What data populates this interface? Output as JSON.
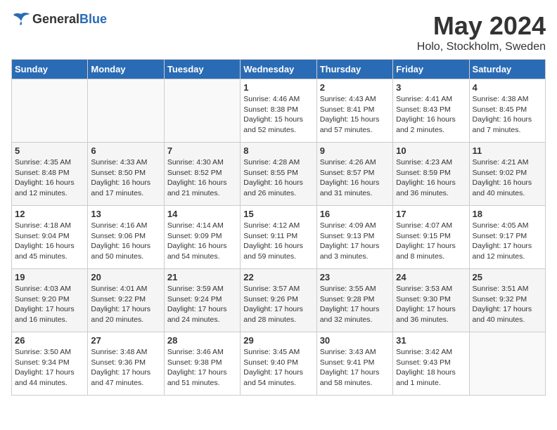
{
  "logo": {
    "general": "General",
    "blue": "Blue"
  },
  "title": "May 2024",
  "location": "Holo, Stockholm, Sweden",
  "days_of_week": [
    "Sunday",
    "Monday",
    "Tuesday",
    "Wednesday",
    "Thursday",
    "Friday",
    "Saturday"
  ],
  "weeks": [
    [
      {
        "day": "",
        "info": ""
      },
      {
        "day": "",
        "info": ""
      },
      {
        "day": "",
        "info": ""
      },
      {
        "day": "1",
        "info": "Sunrise: 4:46 AM\nSunset: 8:38 PM\nDaylight: 15 hours and 52 minutes."
      },
      {
        "day": "2",
        "info": "Sunrise: 4:43 AM\nSunset: 8:41 PM\nDaylight: 15 hours and 57 minutes."
      },
      {
        "day": "3",
        "info": "Sunrise: 4:41 AM\nSunset: 8:43 PM\nDaylight: 16 hours and 2 minutes."
      },
      {
        "day": "4",
        "info": "Sunrise: 4:38 AM\nSunset: 8:45 PM\nDaylight: 16 hours and 7 minutes."
      }
    ],
    [
      {
        "day": "5",
        "info": "Sunrise: 4:35 AM\nSunset: 8:48 PM\nDaylight: 16 hours and 12 minutes."
      },
      {
        "day": "6",
        "info": "Sunrise: 4:33 AM\nSunset: 8:50 PM\nDaylight: 16 hours and 17 minutes."
      },
      {
        "day": "7",
        "info": "Sunrise: 4:30 AM\nSunset: 8:52 PM\nDaylight: 16 hours and 21 minutes."
      },
      {
        "day": "8",
        "info": "Sunrise: 4:28 AM\nSunset: 8:55 PM\nDaylight: 16 hours and 26 minutes."
      },
      {
        "day": "9",
        "info": "Sunrise: 4:26 AM\nSunset: 8:57 PM\nDaylight: 16 hours and 31 minutes."
      },
      {
        "day": "10",
        "info": "Sunrise: 4:23 AM\nSunset: 8:59 PM\nDaylight: 16 hours and 36 minutes."
      },
      {
        "day": "11",
        "info": "Sunrise: 4:21 AM\nSunset: 9:02 PM\nDaylight: 16 hours and 40 minutes."
      }
    ],
    [
      {
        "day": "12",
        "info": "Sunrise: 4:18 AM\nSunset: 9:04 PM\nDaylight: 16 hours and 45 minutes."
      },
      {
        "day": "13",
        "info": "Sunrise: 4:16 AM\nSunset: 9:06 PM\nDaylight: 16 hours and 50 minutes."
      },
      {
        "day": "14",
        "info": "Sunrise: 4:14 AM\nSunset: 9:09 PM\nDaylight: 16 hours and 54 minutes."
      },
      {
        "day": "15",
        "info": "Sunrise: 4:12 AM\nSunset: 9:11 PM\nDaylight: 16 hours and 59 minutes."
      },
      {
        "day": "16",
        "info": "Sunrise: 4:09 AM\nSunset: 9:13 PM\nDaylight: 17 hours and 3 minutes."
      },
      {
        "day": "17",
        "info": "Sunrise: 4:07 AM\nSunset: 9:15 PM\nDaylight: 17 hours and 8 minutes."
      },
      {
        "day": "18",
        "info": "Sunrise: 4:05 AM\nSunset: 9:17 PM\nDaylight: 17 hours and 12 minutes."
      }
    ],
    [
      {
        "day": "19",
        "info": "Sunrise: 4:03 AM\nSunset: 9:20 PM\nDaylight: 17 hours and 16 minutes."
      },
      {
        "day": "20",
        "info": "Sunrise: 4:01 AM\nSunset: 9:22 PM\nDaylight: 17 hours and 20 minutes."
      },
      {
        "day": "21",
        "info": "Sunrise: 3:59 AM\nSunset: 9:24 PM\nDaylight: 17 hours and 24 minutes."
      },
      {
        "day": "22",
        "info": "Sunrise: 3:57 AM\nSunset: 9:26 PM\nDaylight: 17 hours and 28 minutes."
      },
      {
        "day": "23",
        "info": "Sunrise: 3:55 AM\nSunset: 9:28 PM\nDaylight: 17 hours and 32 minutes."
      },
      {
        "day": "24",
        "info": "Sunrise: 3:53 AM\nSunset: 9:30 PM\nDaylight: 17 hours and 36 minutes."
      },
      {
        "day": "25",
        "info": "Sunrise: 3:51 AM\nSunset: 9:32 PM\nDaylight: 17 hours and 40 minutes."
      }
    ],
    [
      {
        "day": "26",
        "info": "Sunrise: 3:50 AM\nSunset: 9:34 PM\nDaylight: 17 hours and 44 minutes."
      },
      {
        "day": "27",
        "info": "Sunrise: 3:48 AM\nSunset: 9:36 PM\nDaylight: 17 hours and 47 minutes."
      },
      {
        "day": "28",
        "info": "Sunrise: 3:46 AM\nSunset: 9:38 PM\nDaylight: 17 hours and 51 minutes."
      },
      {
        "day": "29",
        "info": "Sunrise: 3:45 AM\nSunset: 9:40 PM\nDaylight: 17 hours and 54 minutes."
      },
      {
        "day": "30",
        "info": "Sunrise: 3:43 AM\nSunset: 9:41 PM\nDaylight: 17 hours and 58 minutes."
      },
      {
        "day": "31",
        "info": "Sunrise: 3:42 AM\nSunset: 9:43 PM\nDaylight: 18 hours and 1 minute."
      },
      {
        "day": "",
        "info": ""
      }
    ]
  ]
}
